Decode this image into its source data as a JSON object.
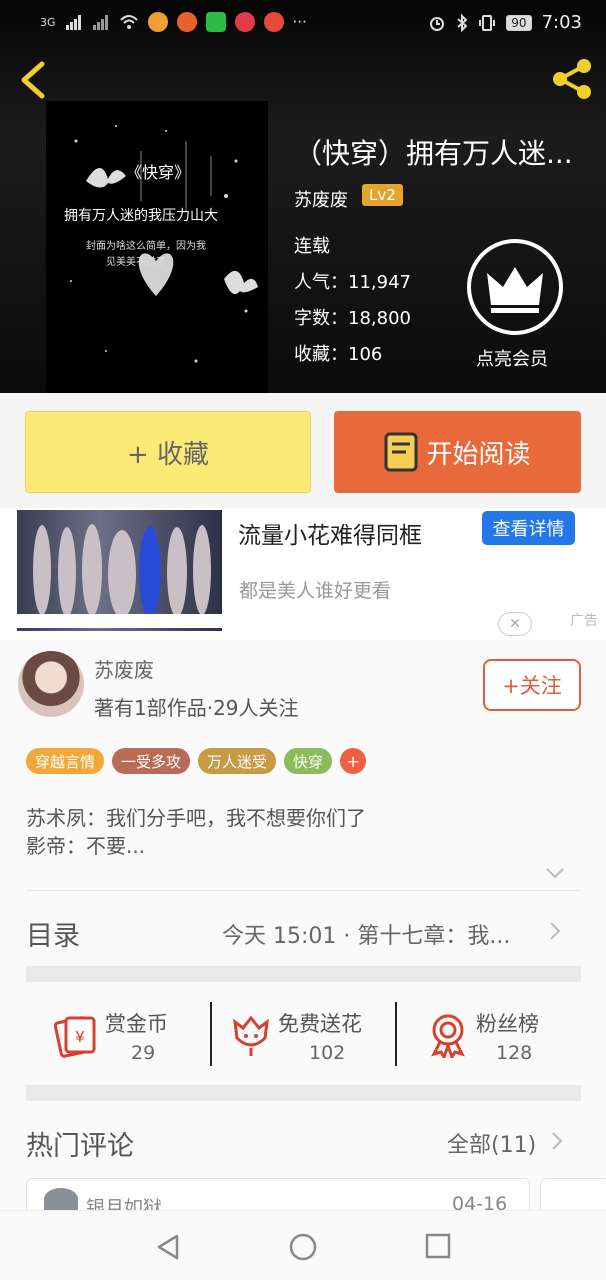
{
  "status_bar": {
    "network": "3G",
    "battery": "90",
    "time": "7:03"
  },
  "book": {
    "title": "（快穿）拥有万人迷...",
    "author": "苏废废",
    "author_level": "Lv2",
    "status": "连载",
    "popularity_label": "人气：",
    "popularity": "11,947",
    "words_label": "字数：",
    "words": "18,800",
    "favorites_label": "收藏：",
    "favorites": "106",
    "vip_label": "点亮会员"
  },
  "cover": {
    "title_text": "《快穿》",
    "line1": "拥有万人迷的我压力山大",
    "line2": "封面为啥这么简单，因为我",
    "line3": "见美美不过了"
  },
  "actions": {
    "favorite_label": "+ 收藏",
    "read_label": "开始阅读"
  },
  "ad": {
    "title": "流量小花难得同框",
    "button": "查看详情",
    "subtitle": "都是美人谁好更看",
    "tag": "广告"
  },
  "author_card": {
    "name": "苏废废",
    "info": "著有1部作品·29人关注",
    "follow_label": "+关注"
  },
  "tags": [
    {
      "label": "穿越言情",
      "color": "#f2a838"
    },
    {
      "label": "一受多攻",
      "color": "#b86c56"
    },
    {
      "label": "万人迷受",
      "color": "#c79a44"
    },
    {
      "label": "快穿",
      "color": "#8dbb5a"
    }
  ],
  "description": {
    "line1": "苏术夙：我们分手吧，我不想要你们了",
    "line2": "影帝：不要..."
  },
  "toc": {
    "label": "目录",
    "latest": "今天 15:01 · 第十七章：我..."
  },
  "stats": [
    {
      "label": "赏金币",
      "value": "29",
      "icon": "red-envelope-icon"
    },
    {
      "label": "免费送花",
      "value": "102",
      "icon": "flower-icon"
    },
    {
      "label": "粉丝榜",
      "value": "128",
      "icon": "medal-icon"
    }
  ],
  "comments": {
    "heading": "热门评论",
    "all_label": "全部(11)",
    "first_user": "银月如狱",
    "first_date": "04-16"
  },
  "colors": {
    "accent_red": "#e05c3c",
    "read_button": "#e86a3c",
    "favorite_button": "#fbeb74",
    "gold": "#e3a52e"
  }
}
